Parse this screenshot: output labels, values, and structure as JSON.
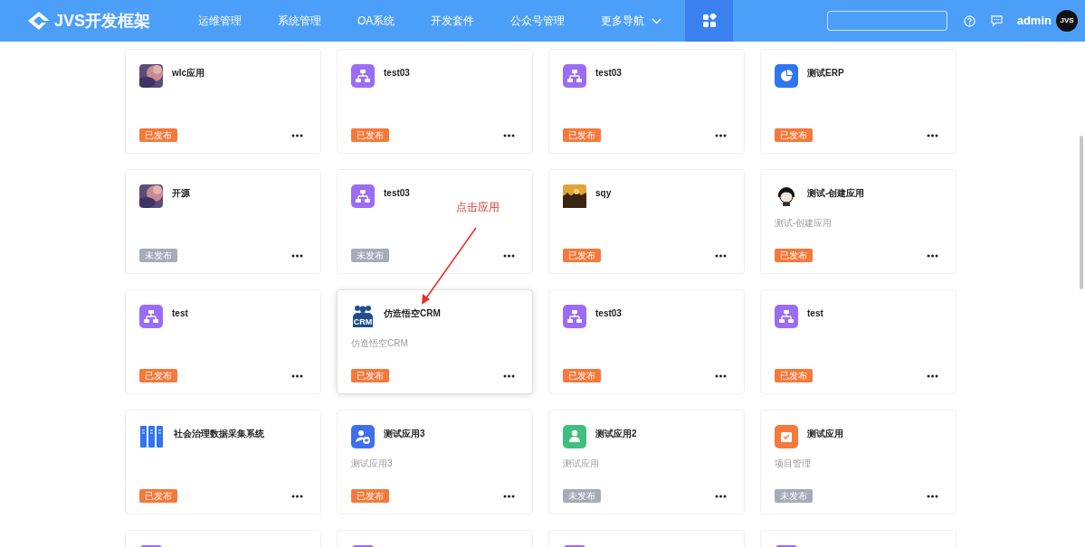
{
  "header": {
    "logo_text": "JVS开发框架",
    "nav": [
      {
        "kind": "text",
        "label": "运维管理",
        "selected": false
      },
      {
        "kind": "text",
        "label": "系统管理",
        "selected": false
      },
      {
        "kind": "text",
        "label": "OA系统",
        "selected": false
      },
      {
        "kind": "text",
        "label": "开发套件",
        "selected": false
      },
      {
        "kind": "text",
        "label": "公众号管理",
        "selected": false
      },
      {
        "kind": "dropdown",
        "label": "更多导航",
        "selected": false
      },
      {
        "kind": "apps",
        "selected": true
      }
    ],
    "user": {
      "name": "admin",
      "avatar_text": "JVS"
    }
  },
  "apps": [
    {
      "name": "wlc应用",
      "status": "已发布",
      "published": true,
      "highlighted": false
    },
    {
      "kind": "tree",
      "name": "test03",
      "status": "已发布",
      "published": true,
      "highlighted": false
    },
    {
      "kind": "tree",
      "name": "test03",
      "status": "已发布",
      "published": true,
      "highlighted": false
    },
    {
      "kind": "pie",
      "name": "测试ERP",
      "status": "已发布",
      "published": true,
      "highlighted": false
    },
    {
      "name": "开源",
      "status": "未发布",
      "published": false,
      "highlighted": false
    },
    {
      "kind": "tree",
      "name": "test03",
      "status": "未发布",
      "published": false,
      "highlighted": false
    },
    {
      "kind": "sunset",
      "name": "sqy",
      "status": "已发布",
      "published": true,
      "highlighted": false
    },
    {
      "kind": "figure",
      "name": "测试-创建应用",
      "description": "测试-创建应用",
      "status": "已发布",
      "published": true,
      "highlighted": false
    },
    {
      "kind": "tree",
      "name": "test",
      "status": "已发布",
      "published": true,
      "highlighted": false
    },
    {
      "kind": "people",
      "icon_label": "CRM",
      "name": "仿造悟空CRM",
      "description": "仿造悟空CRM",
      "status": "已发布",
      "published": true,
      "highlighted": true
    },
    {
      "kind": "tree",
      "name": "test03",
      "status": "已发布",
      "published": true,
      "highlighted": false
    },
    {
      "kind": "tree",
      "name": "test",
      "status": "已发布",
      "published": true,
      "highlighted": false
    },
    {
      "kind": "binders",
      "name": "社会治理数据采集系统",
      "status": "已发布",
      "published": true,
      "highlighted": false
    },
    {
      "kind": "user-plus",
      "name": "测试应用3",
      "description": "测试应用3",
      "status": "已发布",
      "published": true,
      "highlighted": false
    },
    {
      "kind": "person",
      "name": "测试应用2",
      "description": "测试应用",
      "status": "未发布",
      "published": false,
      "highlighted": false
    },
    {
      "kind": "check",
      "name": "测试应用",
      "description": "项目管理",
      "status": "未发布",
      "published": false,
      "highlighted": false
    },
    {
      "kind": "tree",
      "highlighted": false
    },
    {
      "kind": "tree",
      "highlighted": false
    },
    {
      "kind": "tree",
      "highlighted": false
    },
    {
      "kind": "tree",
      "highlighted": false
    }
  ],
  "annotation": {
    "text": "点击应用"
  }
}
